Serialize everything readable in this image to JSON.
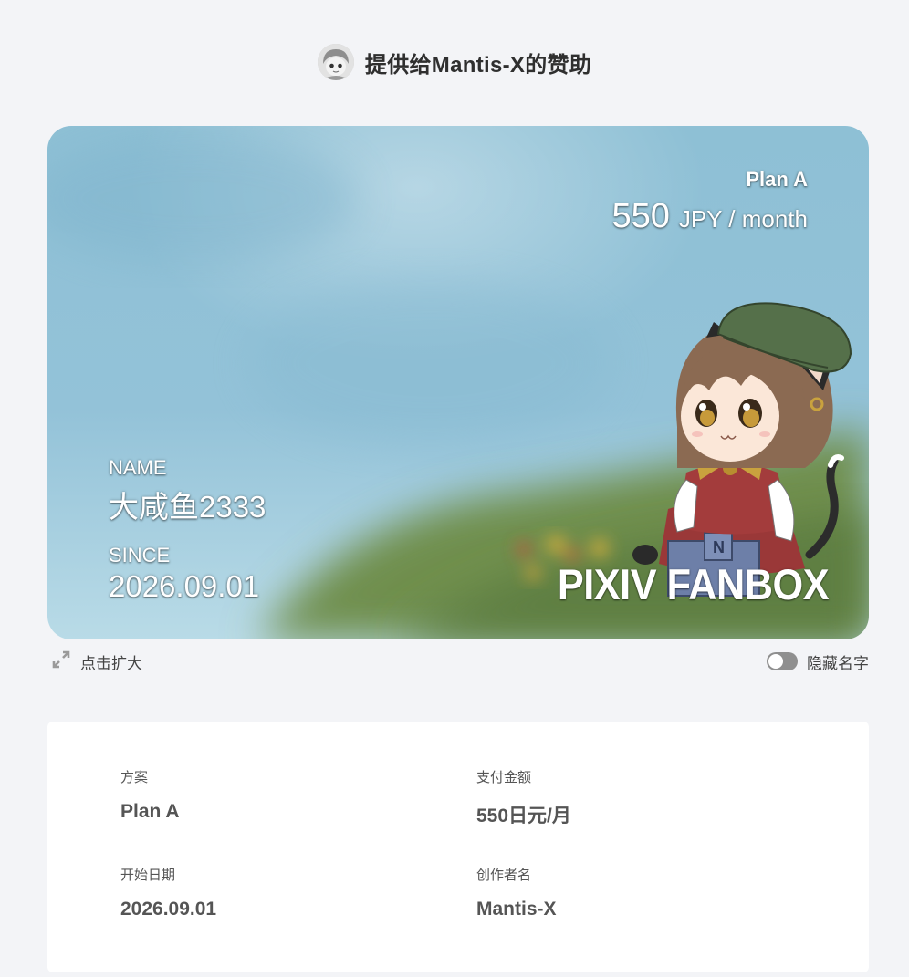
{
  "header": {
    "title": "提供给Mantis-X的赞助",
    "avatar_icon": "creator-avatar"
  },
  "card": {
    "plan_name": "Plan A",
    "price_amount": "550",
    "price_unit": "JPY / month",
    "name_label": "NAME",
    "name_value": "大咸鱼2333",
    "since_label": "SINCE",
    "since_value": "2026.09.01",
    "brand": "PIXIV FANBOX",
    "colors": {
      "sky": "#8ebfd6",
      "grass": "#6a8a4a"
    }
  },
  "controls": {
    "expand_label": "点击扩大",
    "expand_icon": "expand-icon",
    "hide_name_label": "隐藏名字",
    "hide_name_on": false
  },
  "details": {
    "plan_label": "方案",
    "plan_value": "Plan A",
    "amount_label": "支付金额",
    "amount_value": "550日元/月",
    "start_label": "开始日期",
    "start_value": "2026.09.01",
    "creator_label": "创作者名",
    "creator_value": "Mantis-X"
  }
}
